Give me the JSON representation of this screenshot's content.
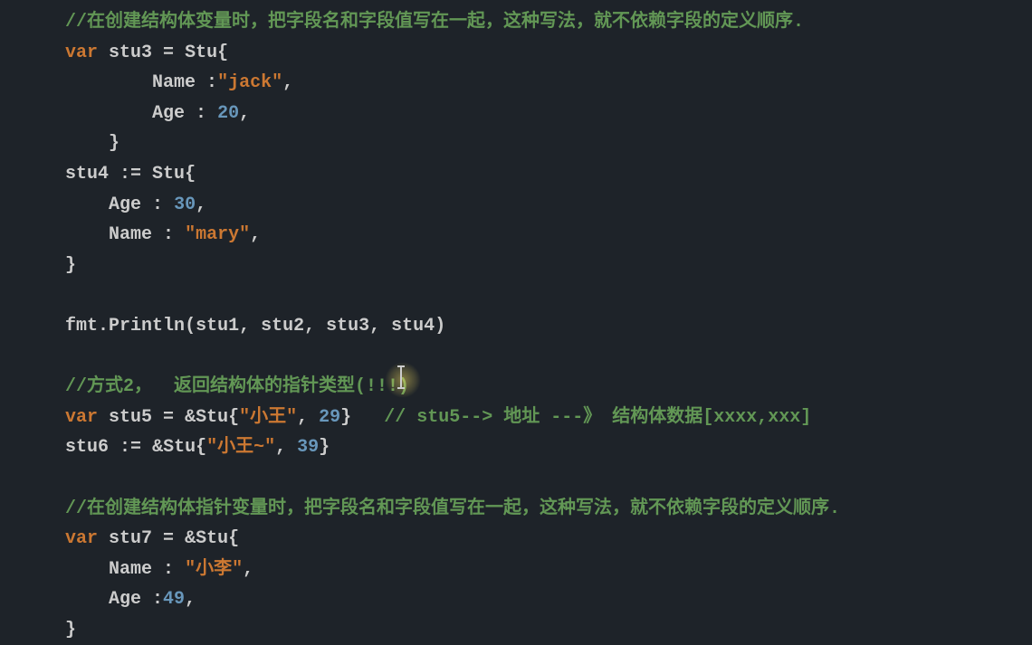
{
  "code": {
    "lines": [
      {
        "indent": 1,
        "parts": [
          {
            "c": "comment",
            "t": "//在创建结构体变量时，把字段名和字段值写在一起，这种写法，就不依赖字段的定义顺序."
          }
        ]
      },
      {
        "indent": 1,
        "parts": [
          {
            "c": "keyword",
            "t": "var"
          },
          {
            "c": "identifier",
            "t": " stu3 "
          },
          {
            "c": "operator",
            "t": "="
          },
          {
            "c": "identifier",
            "t": " Stu"
          },
          {
            "c": "punct",
            "t": "{"
          }
        ]
      },
      {
        "indent": 3,
        "parts": [
          {
            "c": "identifier",
            "t": "Name "
          },
          {
            "c": "operator",
            "t": ":"
          },
          {
            "c": "string",
            "t": "\"jack\""
          },
          {
            "c": "punct",
            "t": ","
          }
        ]
      },
      {
        "indent": 3,
        "parts": [
          {
            "c": "identifier",
            "t": "Age "
          },
          {
            "c": "operator",
            "t": ":"
          },
          {
            "c": "identifier",
            "t": " "
          },
          {
            "c": "number",
            "t": "20"
          },
          {
            "c": "punct",
            "t": ","
          }
        ]
      },
      {
        "indent": 2,
        "parts": [
          {
            "c": "punct",
            "t": "}"
          }
        ]
      },
      {
        "indent": 1,
        "parts": [
          {
            "c": "identifier",
            "t": "stu4 "
          },
          {
            "c": "operator",
            "t": ":="
          },
          {
            "c": "identifier",
            "t": " Stu"
          },
          {
            "c": "punct",
            "t": "{"
          }
        ]
      },
      {
        "indent": 2,
        "parts": [
          {
            "c": "identifier",
            "t": "Age "
          },
          {
            "c": "operator",
            "t": ":"
          },
          {
            "c": "identifier",
            "t": " "
          },
          {
            "c": "number",
            "t": "30"
          },
          {
            "c": "punct",
            "t": ","
          }
        ]
      },
      {
        "indent": 2,
        "parts": [
          {
            "c": "identifier",
            "t": "Name "
          },
          {
            "c": "operator",
            "t": ":"
          },
          {
            "c": "identifier",
            "t": " "
          },
          {
            "c": "string",
            "t": "\"mary\""
          },
          {
            "c": "punct",
            "t": ","
          }
        ]
      },
      {
        "indent": 1,
        "parts": [
          {
            "c": "punct",
            "t": "}"
          }
        ]
      },
      {
        "indent": 1,
        "parts": []
      },
      {
        "indent": 1,
        "parts": [
          {
            "c": "identifier",
            "t": "fmt"
          },
          {
            "c": "punct",
            "t": "."
          },
          {
            "c": "identifier",
            "t": "Println"
          },
          {
            "c": "punct",
            "t": "("
          },
          {
            "c": "identifier",
            "t": "stu1"
          },
          {
            "c": "punct",
            "t": ", "
          },
          {
            "c": "identifier",
            "t": "stu2"
          },
          {
            "c": "punct",
            "t": ", "
          },
          {
            "c": "identifier",
            "t": "stu3"
          },
          {
            "c": "punct",
            "t": ", "
          },
          {
            "c": "identifier",
            "t": "stu4"
          },
          {
            "c": "punct",
            "t": ")"
          }
        ]
      },
      {
        "indent": 1,
        "parts": []
      },
      {
        "indent": 1,
        "parts": [
          {
            "c": "comment",
            "t": "//方式2，  返回结构体的指针类型(!!!)"
          }
        ]
      },
      {
        "indent": 1,
        "parts": [
          {
            "c": "keyword",
            "t": "var"
          },
          {
            "c": "identifier",
            "t": " stu5 "
          },
          {
            "c": "operator",
            "t": "="
          },
          {
            "c": "identifier",
            "t": " "
          },
          {
            "c": "operator",
            "t": "&"
          },
          {
            "c": "identifier",
            "t": "Stu"
          },
          {
            "c": "punct",
            "t": "{"
          },
          {
            "c": "string",
            "t": "\"小王\""
          },
          {
            "c": "punct",
            "t": ", "
          },
          {
            "c": "number",
            "t": "29"
          },
          {
            "c": "punct",
            "t": "}"
          },
          {
            "c": "identifier",
            "t": "   "
          },
          {
            "c": "comment",
            "t": "// stu5--> 地址 ---》 结构体数据[xxxx,xxx]"
          }
        ]
      },
      {
        "indent": 1,
        "parts": [
          {
            "c": "identifier",
            "t": "stu6 "
          },
          {
            "c": "operator",
            "t": ":="
          },
          {
            "c": "identifier",
            "t": " "
          },
          {
            "c": "operator",
            "t": "&"
          },
          {
            "c": "identifier",
            "t": "Stu"
          },
          {
            "c": "punct",
            "t": "{"
          },
          {
            "c": "string",
            "t": "\"小王~\""
          },
          {
            "c": "punct",
            "t": ", "
          },
          {
            "c": "number",
            "t": "39"
          },
          {
            "c": "punct",
            "t": "}"
          }
        ]
      },
      {
        "indent": 1,
        "parts": []
      },
      {
        "indent": 1,
        "parts": [
          {
            "c": "comment",
            "t": "//在创建结构体指针变量时，把字段名和字段值写在一起，这种写法，就不依赖字段的定义顺序."
          }
        ]
      },
      {
        "indent": 1,
        "parts": [
          {
            "c": "keyword",
            "t": "var"
          },
          {
            "c": "identifier",
            "t": " stu7 "
          },
          {
            "c": "operator",
            "t": "="
          },
          {
            "c": "identifier",
            "t": " "
          },
          {
            "c": "operator",
            "t": "&"
          },
          {
            "c": "identifier",
            "t": "Stu"
          },
          {
            "c": "punct",
            "t": "{"
          }
        ]
      },
      {
        "indent": 2,
        "parts": [
          {
            "c": "identifier",
            "t": "Name "
          },
          {
            "c": "operator",
            "t": ":"
          },
          {
            "c": "identifier",
            "t": " "
          },
          {
            "c": "string",
            "t": "\"小李\""
          },
          {
            "c": "punct",
            "t": ","
          }
        ]
      },
      {
        "indent": 2,
        "parts": [
          {
            "c": "identifier",
            "t": "Age "
          },
          {
            "c": "operator",
            "t": ":"
          },
          {
            "c": "number",
            "t": "49"
          },
          {
            "c": "punct",
            "t": ","
          }
        ]
      },
      {
        "indent": 1,
        "parts": [
          {
            "c": "punct",
            "t": "}"
          }
        ]
      }
    ]
  }
}
